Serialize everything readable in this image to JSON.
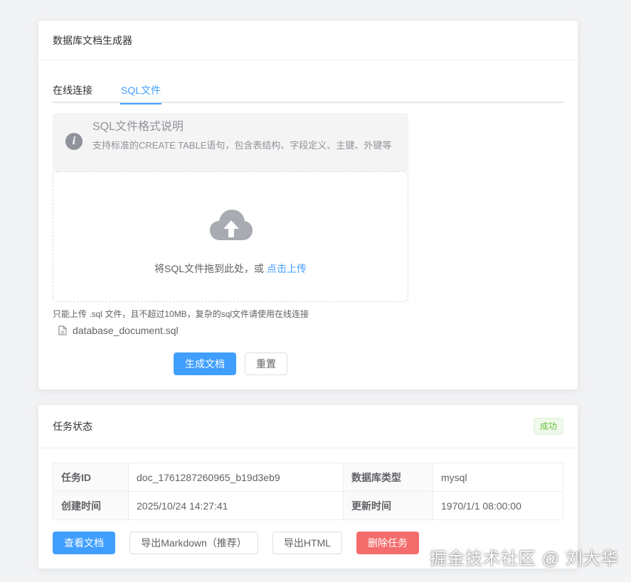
{
  "generator": {
    "title": "数据库文档生成器",
    "tabs": [
      {
        "label": "在线连接",
        "active": false
      },
      {
        "label": "SQL文件",
        "active": true
      }
    ],
    "alert": {
      "icon": "info-icon",
      "title": "SQL文件格式说明",
      "description": "支持标准的CREATE TABLE语句，包含表结构、字段定义、主键、外键等"
    },
    "upload": {
      "icon": "cloud-upload-icon",
      "text": "将SQL文件拖到此处，或 ",
      "link": "点击上传",
      "tip": "只能上传 .sql 文件，且不超过10MB，复杂的sql文件请使用在线连接",
      "file_name": "database_document.sql"
    },
    "buttons": {
      "generate": "生成文档",
      "reset": "重置"
    }
  },
  "task": {
    "title": "任务状态",
    "status": "成功",
    "rows": [
      [
        {
          "label": "任务ID",
          "value": "doc_1761287260965_b19d3eb9"
        },
        {
          "label": "数据库类型",
          "value": "mysql"
        }
      ],
      [
        {
          "label": "创建时间",
          "value": "2025/10/24 14:27:41"
        },
        {
          "label": "更新时间",
          "value": "1970/1/1 08:00:00"
        }
      ]
    ],
    "buttons": {
      "view": "查看文档",
      "export_md": "导出Markdown（推荐）",
      "export_html": "导出HTML",
      "delete": "删除任务"
    }
  },
  "watermark": "掘金技术社区 @ 刘大华",
  "colors": {
    "primary": "#409eff",
    "danger": "#f56c6c",
    "success": "#67c23a",
    "background": "#f2f3f5"
  }
}
